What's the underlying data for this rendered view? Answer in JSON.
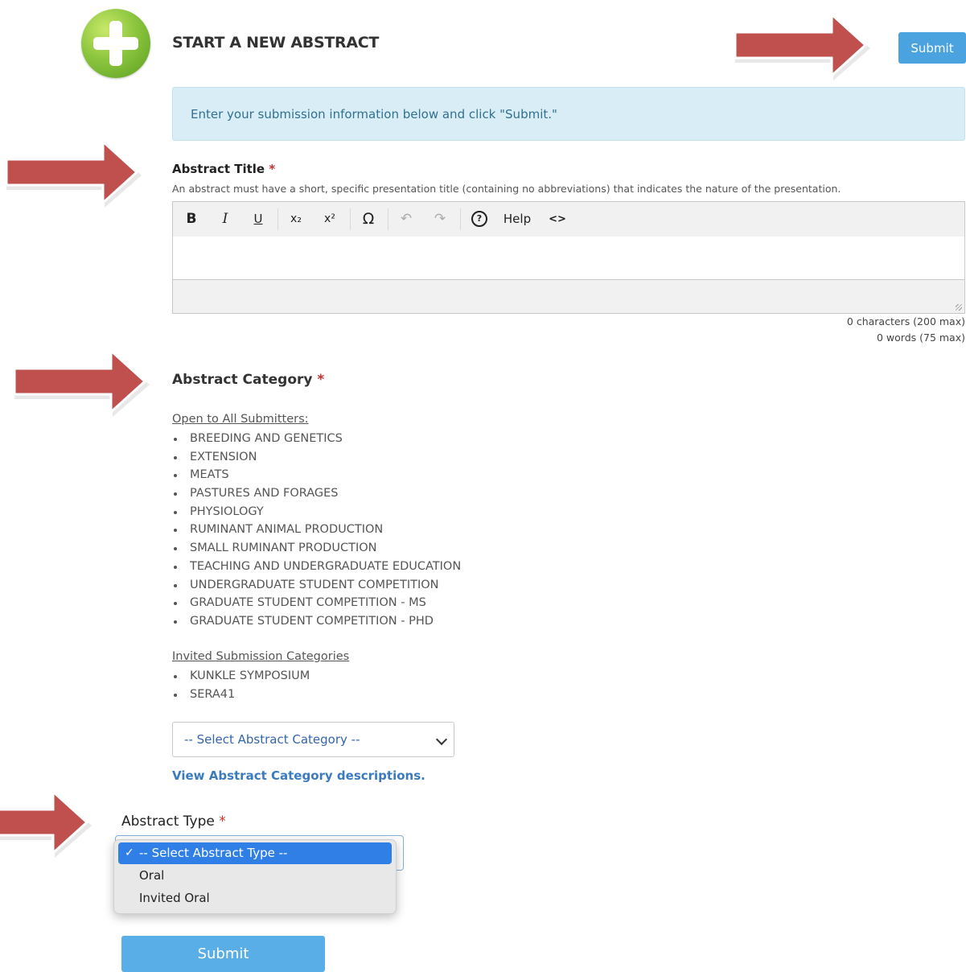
{
  "header": {
    "title": "START A NEW ABSTRACT",
    "submit_label": "Submit"
  },
  "info_message": "Enter your submission information below and click \"Submit.\"",
  "abstract_title": {
    "label": "Abstract Title",
    "required_mark": "*",
    "hint": "An abstract must have a short, specific presentation title (containing no abbreviations) that indicates the nature of the presentation.",
    "toolbar": {
      "bold": "B",
      "italic": "I",
      "underline": "U",
      "subscript": "x₂",
      "superscript": "x²",
      "special_char": "Ω",
      "undo": "↶",
      "redo": "↷",
      "help_icon": "?",
      "help_label": "Help",
      "source": "<>"
    },
    "value": "",
    "char_count": "0 characters (200 max)",
    "word_count": "0 words (75 max)"
  },
  "abstract_category": {
    "label": "Abstract Category",
    "required_mark": "*",
    "open_heading": "Open to All Submitters:",
    "open_items": [
      "BREEDING AND GENETICS",
      "EXTENSION",
      "MEATS",
      "PASTURES AND FORAGES",
      "PHYSIOLOGY",
      "RUMINANT ANIMAL PRODUCTION",
      "SMALL RUMINANT PRODUCTION",
      "TEACHING AND UNDERGRADUATE EDUCATION",
      "UNDERGRADUATE STUDENT COMPETITION",
      "GRADUATE STUDENT COMPETITION - MS",
      "GRADUATE STUDENT COMPETITION - PHD"
    ],
    "invited_heading": "Invited Submission Categories",
    "invited_items": [
      "KUNKLE SYMPOSIUM",
      "SERA41"
    ],
    "select_value": "-- Select Abstract Category --",
    "view_link": "View Abstract Category descriptions."
  },
  "abstract_type": {
    "label": "Abstract Type",
    "required_mark": "*",
    "options": [
      "-- Select Abstract Type --",
      "Oral",
      "Invited Oral"
    ],
    "selected_check": "✓"
  },
  "footer": {
    "submit_label": "Submit"
  },
  "colors": {
    "accent": "#4aa3df",
    "info_bg": "#d9edf7",
    "arrow": "#c0504d",
    "required": "#c9302c"
  }
}
